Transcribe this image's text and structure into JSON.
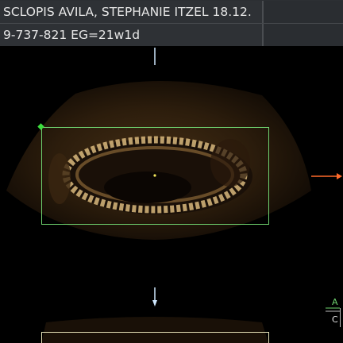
{
  "patient": {
    "name_line": "SCLOPIS AVILA, STEPHANIE ITZEL 18.12.",
    "id_line": "9-737-821  EG=21w1d"
  },
  "side_labels": {
    "upper": "A",
    "lower": "C"
  },
  "colors": {
    "roi_box": "#6fd36f",
    "roi_anchor": "#3ddc3d",
    "direction_arrow": "#ff6a2a",
    "lower_box": "#e6e2b8"
  }
}
